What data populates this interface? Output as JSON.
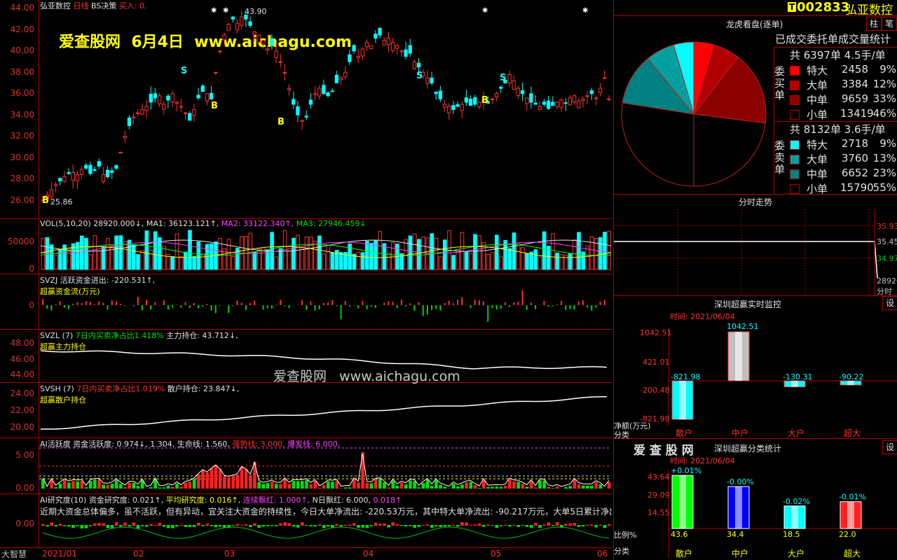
{
  "kline": {
    "title": "弘亚数控",
    "period": "日线",
    "strategy": "BS决策",
    "signal": "买入: 0,",
    "max_label": "43.90",
    "min_label": "25.86",
    "watermark": "爱查股网  6月4日  www.aichagu.com",
    "yticks": [
      "44.00",
      "42.00",
      "40.00",
      "38.00",
      "36.00",
      "34.00",
      "32.00",
      "30.00",
      "28.00",
      "26.00"
    ],
    "markers": [
      {
        "t": "B",
        "c": "#ffff00"
      },
      {
        "t": "S",
        "c": "#00ffff"
      },
      {
        "t": "B",
        "c": "#ffff00"
      },
      {
        "t": "B",
        "c": "#ffff00"
      },
      {
        "t": "S",
        "c": "#00ffff"
      },
      {
        "t": "B",
        "c": "#ffff00"
      },
      {
        "t": "S",
        "c": "#00ffff"
      }
    ]
  },
  "vol": {
    "name": "VOL(5,10,20)",
    "value": "28920.000↓,",
    "ma1": "MA1: 36123.121↑,",
    "ma2": "MA2: 33122.340↑,",
    "ma3": "MA3: 27946.459↓",
    "yticks": [
      "50000",
      "0"
    ]
  },
  "svzj": {
    "name": "SVZJ",
    "desc": "活跃资金进出: -220.531↑,",
    "sub": "超赢资金流(万元)",
    "yticks": [
      "0"
    ]
  },
  "svzl": {
    "name": "SVZL (7)",
    "ratio": "7日内买卖净占比1.418%",
    "hold": "主力持仓: 43.712↓,",
    "sub": "超赢主力持仓",
    "yticks": [
      "48.00",
      "46.00",
      "44.00"
    ],
    "watermark": "爱查股网   www.aichagu.com"
  },
  "svsh": {
    "name": "SVSH (7)",
    "ratio": "7日内买卖净占比1.019%",
    "hold": "散户持仓: 23.847↓,",
    "sub": "超赢散户持仓",
    "yticks": [
      "24.00",
      "22.00",
      "20.00"
    ]
  },
  "ai_active": {
    "name": "AI活跃度",
    "v1": "资金活跃度: 0.974↓,",
    "v2": "1.304,",
    "v3": "生命线: 1.560,",
    "v4": "强势线: 3.000,",
    "v5": "爆发线: 6.000,",
    "yticks": [
      "5.00",
      "0.00"
    ]
  },
  "ai_research": {
    "name": "AI研究度(10)",
    "v1": "资金研究度: 0.021↑,",
    "v2": "平均研究度: 0.016↑,",
    "v3": "连续飘红: 1.000↑,",
    "v4": "N日飘红: 6.000,",
    "v5": "0.018↑",
    "comment": "近期大资金总体偏多，虽不活跃，但有异动，宜关注大资金的持续性，今日大单净流出: -220.53万元，其中特大单净流出: -90.217万元，大单5日累计净出",
    "yticks": [
      "0.00"
    ]
  },
  "dates": [
    "2021/01",
    "02",
    "03",
    "04",
    "05",
    "06"
  ],
  "footer": "大智慧",
  "stock": {
    "badge": "T",
    "code": "002833",
    "name": "弘亚数控"
  },
  "tabs": {
    "bar": "柱",
    "pen": "笔"
  },
  "lhb": {
    "title": "龙虎看盘(逐单)",
    "stat_title": "已成交委托单成交量统计",
    "buy": {
      "label": "委买单",
      "total": "共 6397单 4.5手/单",
      "rows": [
        {
          "name": "特大",
          "vol": "2458",
          "pct": "9%",
          "color": "#ff0000"
        },
        {
          "name": "大单",
          "vol": "3384",
          "pct": "12%",
          "color": "#b00000"
        },
        {
          "name": "中单",
          "vol": "9659",
          "pct": "33%",
          "color": "#8a0000"
        },
        {
          "name": "小单",
          "vol": "13419",
          "pct": "46%",
          "color": "#000000"
        }
      ]
    },
    "sell": {
      "label": "委卖单",
      "total": "共 8132单 3.6手/单",
      "rows": [
        {
          "name": "特大",
          "vol": "2718",
          "pct": "9%",
          "color": "#00ffff"
        },
        {
          "name": "大单",
          "vol": "3760",
          "pct": "13%",
          "color": "#00a0a0"
        },
        {
          "name": "中单",
          "vol": "6652",
          "pct": "23%",
          "color": "#008080"
        },
        {
          "name": "小单",
          "vol": "15790",
          "pct": "55%",
          "color": "#000000"
        }
      ]
    }
  },
  "fenshi": {
    "title": "分时走势",
    "yticks": [
      "35.93",
      "35.45",
      "34.97",
      "28920",
      "分时"
    ]
  },
  "monitor": {
    "title": "深圳超赢实时监控",
    "set": "设",
    "time": "时间: 2021/06/04",
    "ylabel": "净额(万元)",
    "cat_label": "分类",
    "yticks": [
      "1042.51",
      "421.01",
      "-200.48",
      "-821.98"
    ],
    "cats": [
      "散户",
      "中户",
      "大户",
      "超大"
    ],
    "values": [
      "-821.98",
      "1042.51",
      "-130.31",
      "-90.22"
    ]
  },
  "classify": {
    "brand": "爱 查 股 网",
    "title": "深圳超赢分类统计",
    "set": "设",
    "time": "时间: 2021/06/04",
    "ylabel": "比例%",
    "cat_label": "分类",
    "yticks": [
      "43.64",
      "29.09",
      "14.55"
    ],
    "cats": [
      "散户",
      "中户",
      "大户",
      "超大"
    ],
    "changes": [
      "+0.01%",
      "-0.00%",
      "-0.02%",
      "-0.01%"
    ],
    "values": [
      "43.6",
      "34.4",
      "18.5",
      "22.0"
    ]
  }
}
